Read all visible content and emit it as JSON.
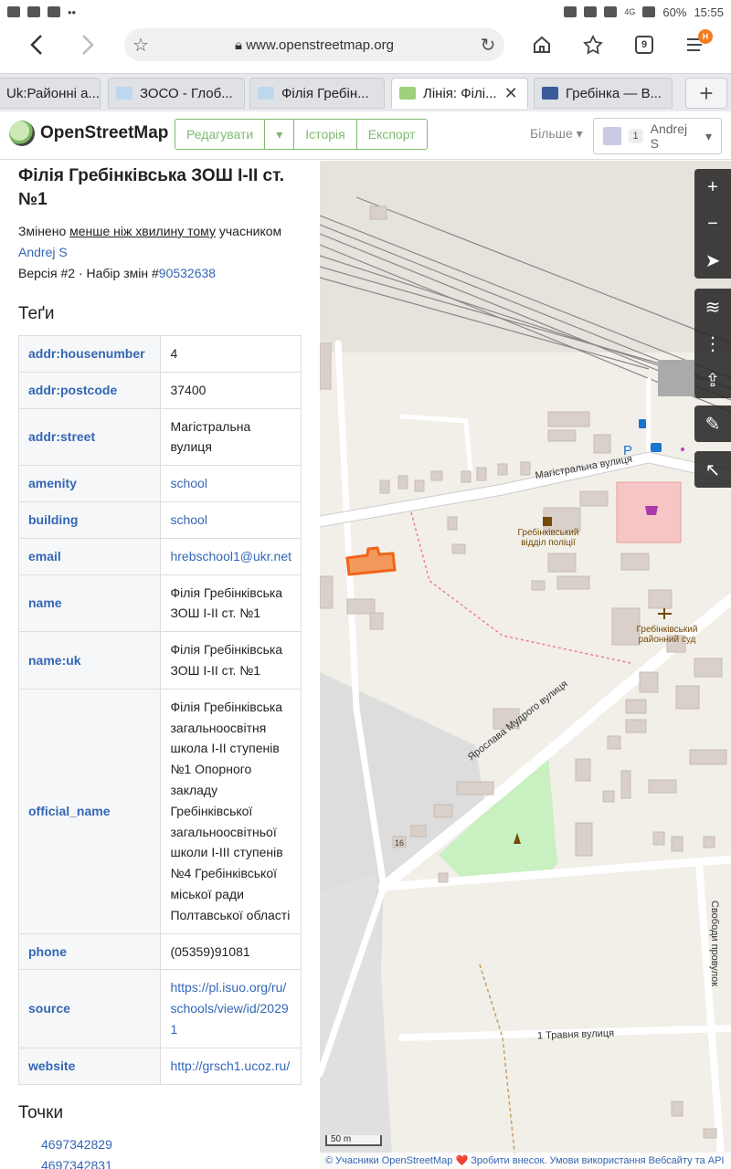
{
  "status": {
    "battery": "60%",
    "time": "15:55",
    "network": "4G"
  },
  "browser": {
    "url": "www.openstreetmap.org",
    "tab_count": "9",
    "menu_badge": "Н",
    "tabs": [
      {
        "title": "Uk:Районні а..."
      },
      {
        "title": "ЗОСО - Глоб..."
      },
      {
        "title": "Філія Гребін..."
      },
      {
        "title": "Лінія: Філі..."
      },
      {
        "title": "Гребінка — В..."
      }
    ]
  },
  "osm": {
    "brand": "OpenStreetMap",
    "edit_label": "Редагувати",
    "history_label": "Історія",
    "export_label": "Експорт",
    "more_label": "Більше",
    "user_badge": "1",
    "user_name": "Andrej S"
  },
  "feature": {
    "title": "Філія Гребінківська ЗОШ І-ІІ ст. №1",
    "changed_prefix": "Змінено",
    "changed_time": "менше ніж хвилину тому",
    "changed_by": "учасником",
    "author": "Andrej S",
    "version_text": "Версія #2 · Набір змін #",
    "changeset": "90532638",
    "tags_heading": "Теґи",
    "tags": [
      {
        "key": "addr:housenumber",
        "value": "4"
      },
      {
        "key": "addr:postcode",
        "value": "37400"
      },
      {
        "key": "addr:street",
        "value": "Магістральна вулиця"
      },
      {
        "key": "amenity",
        "value": "school"
      },
      {
        "key": "building",
        "value": "school"
      },
      {
        "key": "email",
        "value": "hrebschool1@ukr.net"
      },
      {
        "key": "name",
        "value": "Філія Гребінківська ЗОШ І-ІІ ст. №1"
      },
      {
        "key": "name:uk",
        "value": "Філія Гребінківська ЗОШ І-ІІ ст. №1"
      },
      {
        "key": "official_name",
        "value": "Філія Гребінківська загальноосвітня школа I-II ступенів №1 Опорного закладу Гребінківської загальноосвітньої школи I-III ступенів №4 Гребінківської міської ради Полтавської області"
      },
      {
        "key": "phone",
        "value": "(05359)91081"
      },
      {
        "key": "source",
        "value": "https://pl.isuo.org/ru/schools/view/id/20291"
      },
      {
        "key": "website",
        "value": "http://grsch1.ucoz.ru/"
      }
    ],
    "nodes_heading": "Точки",
    "nodes": [
      "4697342829",
      "4697342831"
    ]
  },
  "map": {
    "street_magistralna": "Магістральна вулиця",
    "street_mudrogo": "Ярослава Мудрого вулиця",
    "street_1travnya": "1 Травня вулиця",
    "street_svobody": "Свободи провулок",
    "police": "Гребінківський відділ поліції",
    "court": "Гребінківський районний суд",
    "house_16": "16",
    "scale_m": "50 m",
    "attribution": "© Учасники OpenStreetMap ❤️ Зробити внесок. Умови використання Вебсайту та API",
    "colors": {
      "highlight": "#f07b2a",
      "park": "#c8f0c0",
      "shop": "#f6c6c6",
      "building": "#d9d0c9"
    }
  }
}
